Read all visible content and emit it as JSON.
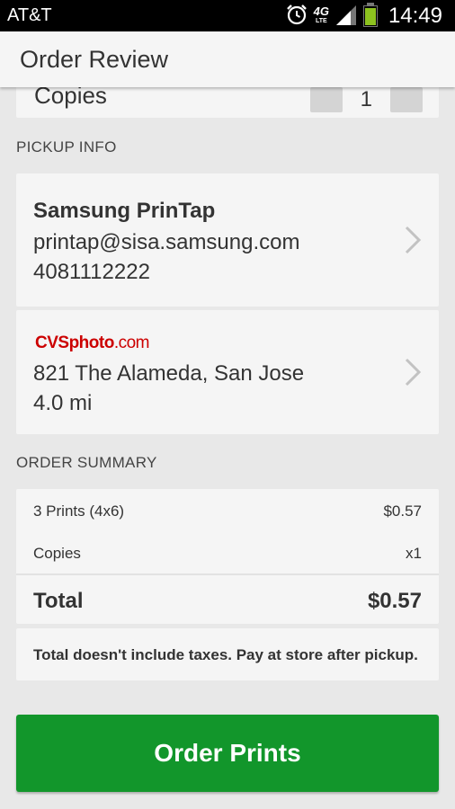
{
  "status_bar": {
    "carrier": "AT&T",
    "time": "14:49",
    "network": "4G",
    "network_sub": "LTE",
    "icons": [
      "alarm-icon",
      "signal-icon",
      "battery-icon"
    ],
    "battery_level": 0.85
  },
  "app_bar": {
    "title": "Order Review"
  },
  "copies": {
    "label": "Copies",
    "value": "1",
    "minus_icon": "minus-icon",
    "plus_icon": "plus-icon"
  },
  "pickup_info": {
    "section_label": "PICKUP INFO",
    "contact": {
      "name": "Samsung PrinTap",
      "email": "printap@sisa.samsung.com",
      "phone": "4081112222"
    },
    "store": {
      "logo_brand": "CVSphoto",
      "logo_domain": ".com",
      "address": "821 The Alameda, San Jose",
      "distance": "4.0 mi"
    }
  },
  "order_summary": {
    "section_label": "ORDER SUMMARY",
    "rows": [
      {
        "label": "3 Prints (4x6)",
        "value": "$0.57"
      },
      {
        "label": "Copies",
        "value": "x1"
      }
    ],
    "total": {
      "label": "Total",
      "value": "$0.57"
    },
    "note": "Total doesn't include taxes. Pay at store after pickup."
  },
  "order_button": {
    "label": "Order Prints"
  },
  "colors": {
    "accent_green": "#12962b",
    "cvs_red": "#cc0000",
    "background": "#e8e8e8",
    "card": "#f5f5f5"
  }
}
